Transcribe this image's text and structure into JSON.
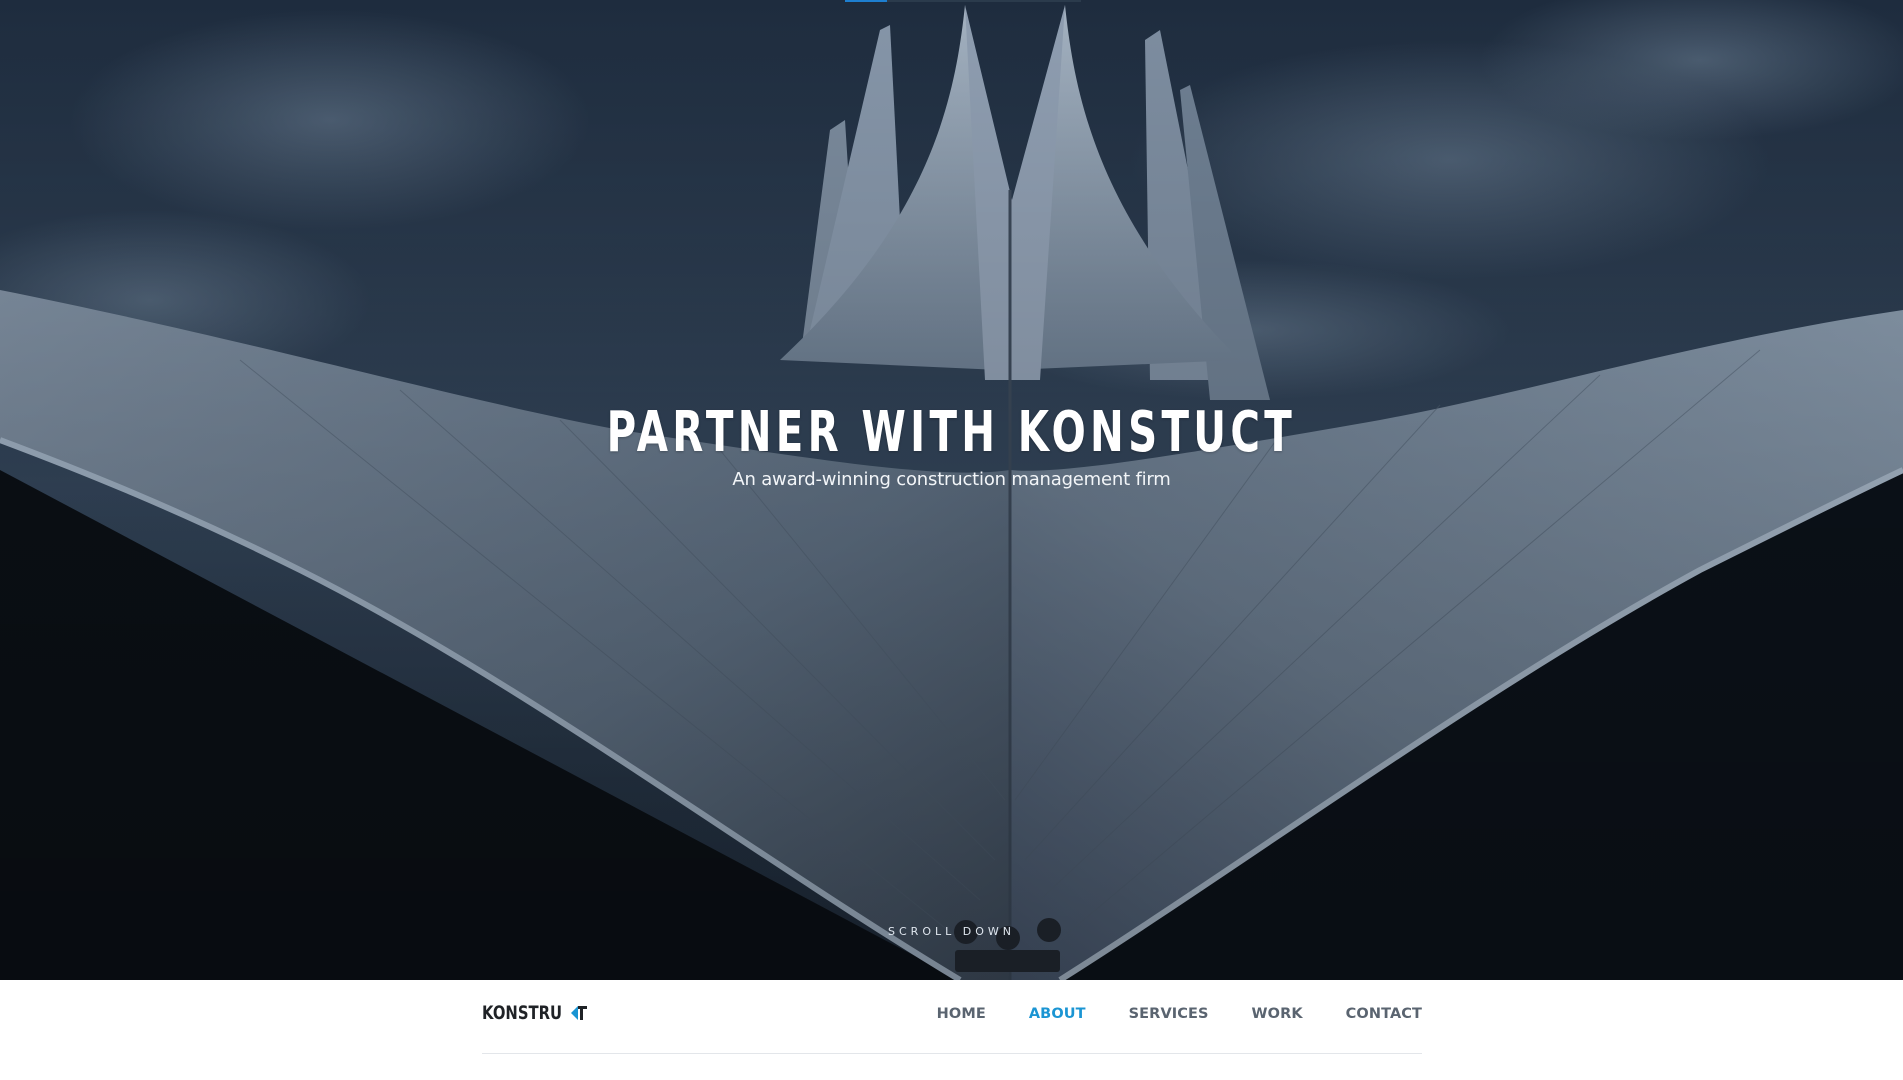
{
  "hero": {
    "title": "PARTNER WITH KONSTUCT",
    "subtitle": "An award-winning construction management firm",
    "scroll_label": "SCROLL DOWN"
  },
  "brand": {
    "logo_text": "KONSTRU",
    "logo_mark_icon": "konstrukt-c-mark-icon",
    "accent_color": "#1b95d3"
  },
  "nav": {
    "items": [
      {
        "label": "HOME",
        "active": false
      },
      {
        "label": "ABOUT",
        "active": true
      },
      {
        "label": "SERVICES",
        "active": false
      },
      {
        "label": "WORK",
        "active": false
      },
      {
        "label": "CONTACT",
        "active": false
      }
    ]
  }
}
